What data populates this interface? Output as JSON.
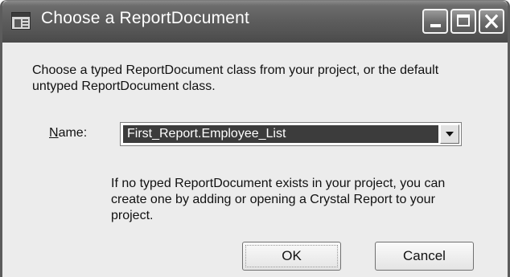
{
  "window": {
    "title": "Choose a ReportDocument",
    "icon": "app-window-icon",
    "controls": {
      "minimize_icon": "minimize-icon",
      "maximize_icon": "maximize-icon",
      "close_icon": "close-icon"
    }
  },
  "dialog": {
    "description": "Choose a typed ReportDocument class from your project, or the default untyped ReportDocument class.",
    "name_label_mnemonic": "N",
    "name_label_rest": "ame:",
    "name_value": "First_Report.Employee_List",
    "dropdown_icon": "chevron-down-icon",
    "hint": "If no typed ReportDocument exists in your project, you can create one by adding or opening a Crystal Report to your project.",
    "ok_label": "OK",
    "cancel_label": "Cancel"
  }
}
